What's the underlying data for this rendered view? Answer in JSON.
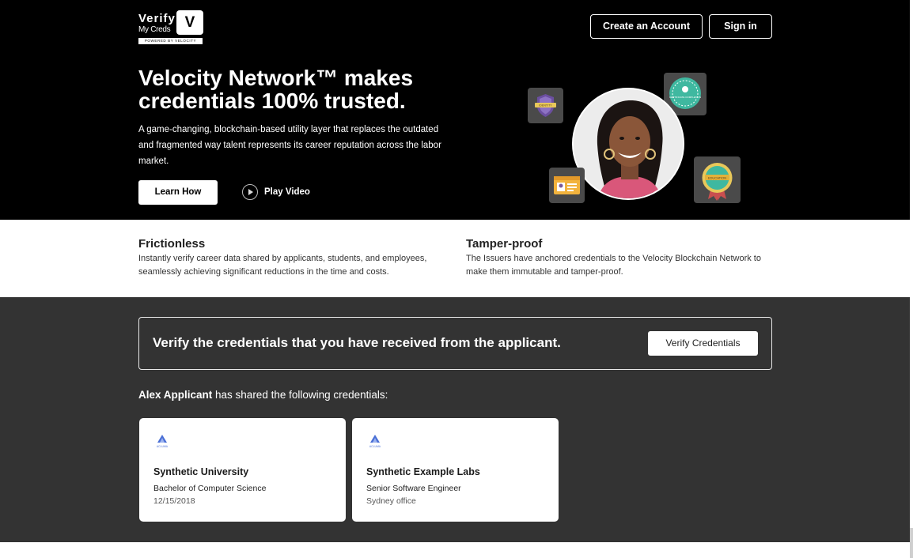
{
  "header": {
    "logo": {
      "word": "Verify",
      "subword": "My Creds",
      "mark": "V",
      "powered_by": "POWERED BY VELOCITY"
    },
    "create_account_label": "Create an Account",
    "sign_in_label": "Sign in"
  },
  "hero": {
    "title_line1": "Velocity Network™ makes",
    "title_line2": "credentials 100% trusted.",
    "description": "A game-changing, blockchain-based utility layer that replaces the outdated and fragmented way talent represents its career reputation across the labor market.",
    "learn_how_label": "Learn How",
    "play_video_label": "Play Video",
    "illustration_icons": [
      "identity-badge-icon",
      "certificate-seal-icon",
      "id-card-icon",
      "education-medal-icon"
    ],
    "badge_labels": {
      "identity": "IDENTITY",
      "certificate": "CERTIFICATE COMPLETION",
      "education": "EDUCATION"
    }
  },
  "features": [
    {
      "title": "Frictionless",
      "description": "Instantly verify career data shared by applicants, students, and employees, seamlessly achieving significant reductions in the time and costs."
    },
    {
      "title": "Tamper-proof",
      "description": "The Issuers have anchored credentials to the Velocity Blockchain Network to make them immutable and tamper-proof."
    }
  ],
  "verify_banner": {
    "text": "Verify the credentials that you have received from the applicant.",
    "button_label": "Verify Credentials"
  },
  "shared_line": {
    "name": "Alex Applicant",
    "rest": " has shared the following credentials:"
  },
  "credentials": [
    {
      "issuer_logo_text": "ACLUMA",
      "title": "Synthetic University",
      "subtitle": "Bachelor of Computer Science",
      "meta": "12/15/2018"
    },
    {
      "issuer_logo_text": "ACLUMA",
      "title": "Synthetic Example Labs",
      "subtitle": "Senior Software Engineer",
      "meta": "Sydney office"
    }
  ],
  "colors": {
    "hero_bg": "#000000",
    "dark_section_bg": "#333333",
    "card_bg": "#ffffff",
    "badge_bg": "#4a4a4a",
    "accent_teal": "#3fb8a0",
    "accent_purple": "#6b4fa0"
  }
}
